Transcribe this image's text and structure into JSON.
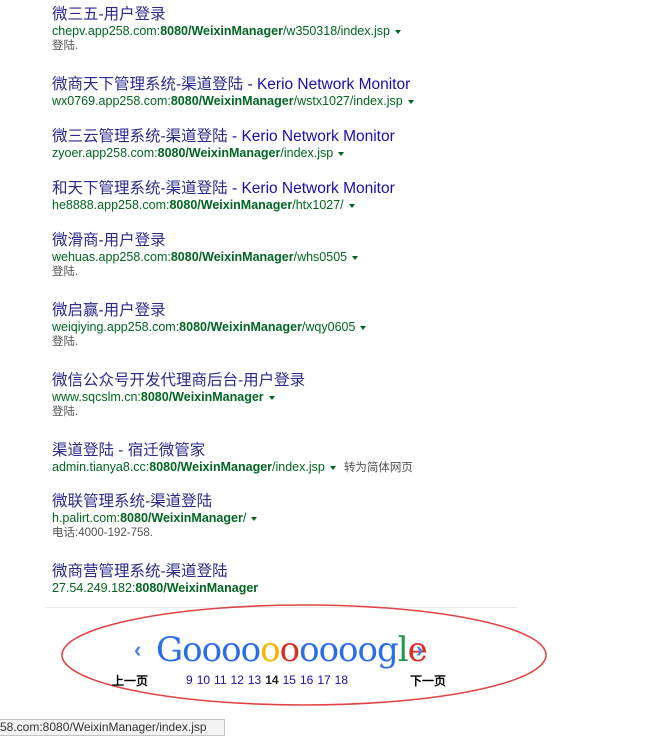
{
  "results": [
    {
      "title": "微三五-用户登录",
      "suffix": "",
      "url_pre": "chepv.app258.com:",
      "url_bold": "8080/WeixinManager",
      "url_post": "/w350318/index.jsp",
      "snippet": "登陆."
    },
    {
      "title": "微商天下管理系统-渠道登陆",
      "suffix": " - Kerio Network Monitor",
      "url_pre": "wx0769.app258.com:",
      "url_bold": "8080/WeixinManager",
      "url_post": "/wstx1027/index.jsp",
      "snippet": ""
    },
    {
      "title": "微三云管理系统-渠道登陆",
      "suffix": " - Kerio Network Monitor",
      "url_pre": "zyoer.app258.com:",
      "url_bold": "8080/WeixinManager",
      "url_post": "/index.jsp",
      "snippet": ""
    },
    {
      "title": "和天下管理系统-渠道登陆",
      "suffix": " - Kerio Network Monitor",
      "url_pre": "he8888.app258.com:",
      "url_bold": "8080/WeixinManager",
      "url_post": "/htx1027/",
      "snippet": ""
    },
    {
      "title": "微滑商-用户登录",
      "suffix": "",
      "url_pre": "wehuas.app258.com:",
      "url_bold": "8080/WeixinManager",
      "url_post": "/whs0505",
      "snippet": "登陆."
    },
    {
      "title": "微启赢-用户登录",
      "suffix": "",
      "url_pre": "weiqiying.app258.com:",
      "url_bold": "8080/WeixinManager",
      "url_post": "/wqy0605",
      "snippet": "登陆."
    },
    {
      "title": "微信公众号开发代理商后台-用户登录",
      "suffix": "",
      "url_pre": "www.sqcslm.cn:",
      "url_bold": "8080/WeixinManager",
      "url_post": "",
      "snippet": "登陆."
    },
    {
      "title": "渠道登陆 - 宿迁微管家",
      "suffix": "",
      "url_pre": "admin.tianya8.cc:",
      "url_bold": "8080/WeixinManager",
      "url_post": "/index.jsp",
      "snippet": "",
      "translate": "转为简体网页"
    },
    {
      "title": "微联管理系统-渠道登陆",
      "suffix": "",
      "url_pre": "h.palirt.com:",
      "url_bold": "8080/WeixinManager",
      "url_post": "/",
      "snippet": "电话:4000-192-758."
    },
    {
      "title": "微商营管理系统-渠道登陆",
      "suffix": "",
      "url_pre": "27.54.249.182:",
      "url_bold": "8080/WeixinManager",
      "url_post": "",
      "snippet": "",
      "no_caret": true
    }
  ],
  "pagination": {
    "prev_label": "上一页",
    "next_label": "下一页",
    "prev_arrow": "‹",
    "next_arrow": "›",
    "logo_letters": [
      "G",
      "o",
      "o",
      "o",
      "o",
      "o",
      "o",
      "o",
      "o",
      "o",
      "o",
      "g",
      "l",
      "e"
    ],
    "logo_colors": [
      "#2a6de8",
      "#2a6de8",
      "#2a6de8",
      "#2a6de8",
      "#2a6de8",
      "#f2b400",
      "#d93025",
      "#2a6de8",
      "#2a6de8",
      "#2a6de8",
      "#2a6de8",
      "#2a6de8",
      "#1e9a4c",
      "#d93025"
    ],
    "pages": [
      "9",
      "10",
      "11",
      "12",
      "13",
      "14",
      "15",
      "16",
      "17",
      "18"
    ],
    "current_page": "14"
  },
  "status_bar": {
    "text": "58.com:8080/WeixinManager/index.jsp"
  },
  "colors": {
    "annotation_ellipse": "#e04545"
  }
}
